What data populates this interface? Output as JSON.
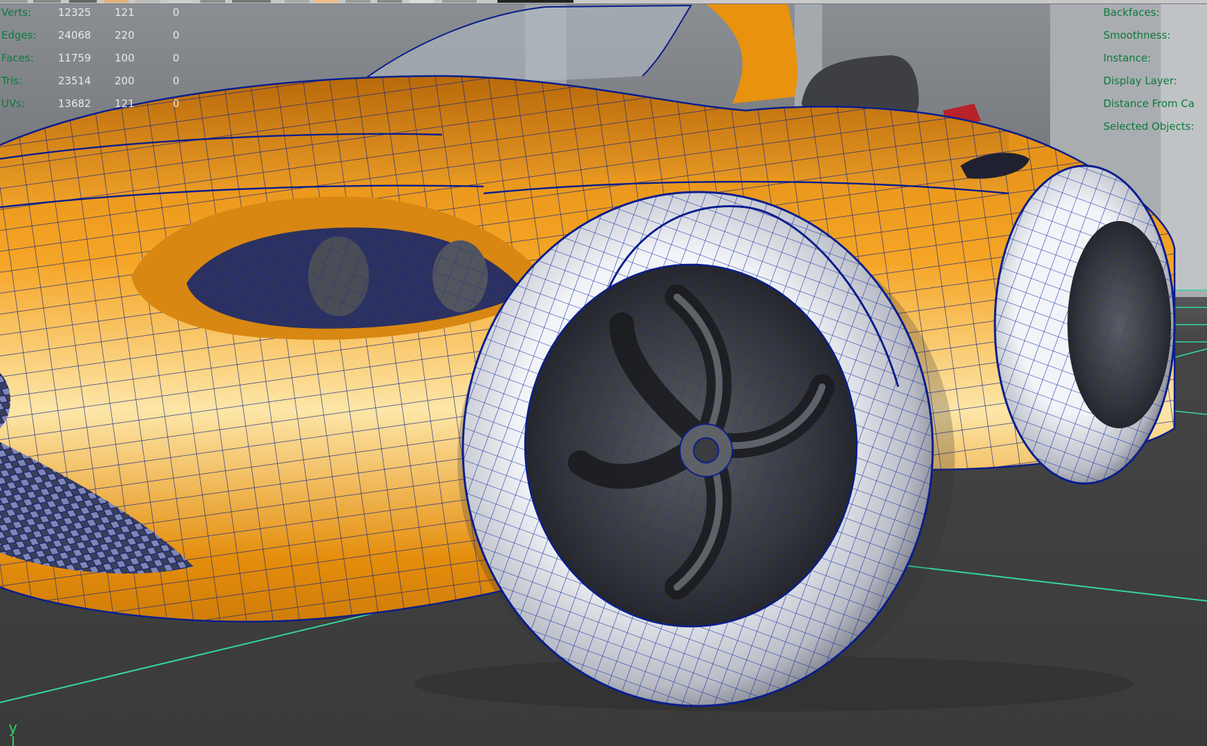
{
  "hud_left": {
    "rows": [
      {
        "label": "Verts:",
        "v1": "12325",
        "v2": "121",
        "v3": "0"
      },
      {
        "label": "Edges:",
        "v1": "24068",
        "v2": "220",
        "v3": "0"
      },
      {
        "label": "Faces:",
        "v1": "11759",
        "v2": "100",
        "v3": "0"
      },
      {
        "label": "Tris:",
        "v1": "23514",
        "v2": "200",
        "v3": "0"
      },
      {
        "label": "UVs:",
        "v1": "13682",
        "v2": "121",
        "v3": "0"
      }
    ]
  },
  "hud_right": {
    "labels": [
      "Backfaces:",
      "Smoothness:",
      "Instance:",
      "Display Layer:",
      "Distance From Ca",
      "Selected Objects:"
    ]
  },
  "axis": {
    "label": "y"
  },
  "colors": {
    "viewport_bg": "#3f3f3f",
    "hud_label": "#0c7a3a",
    "hud_value": "#e9e9e9",
    "grid_line": "#35d6a0",
    "body_paint": "#e8920e",
    "wireframe": "#0a1e8c",
    "tire": "#d8dbe3",
    "rim": "#3b3d44"
  }
}
